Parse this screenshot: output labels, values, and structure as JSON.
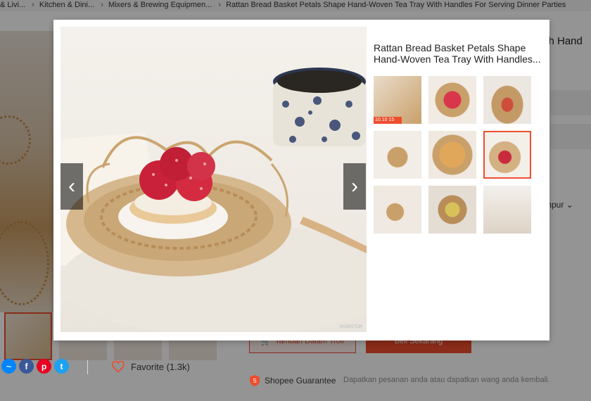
{
  "breadcrumb": {
    "items": [
      "& Livi...",
      "Kitchen & Dini...",
      "Mixers & Brewing Equipmen...",
      "Rattan Bread Basket Petals Shape Hand-Woven Tea Tray With Handles For Serving Dinner Parties"
    ]
  },
  "page": {
    "title_partial": "ith Hand",
    "option_partial": "mpur",
    "add_to_cart_label": "Tambah Dalam Troli",
    "buy_now_label": "Beli Sekarang",
    "favorite_label": "Favorite (1.3k)",
    "guarantee_label": "Shopee Guarantee",
    "guarantee_desc": "Dapatkan pesanan anda atau dapatkan wang anda kembali.",
    "share_icons": [
      "messenger-icon",
      "facebook-icon",
      "pinterest-icon",
      "twitter-icon"
    ]
  },
  "modal": {
    "title": "Rattan Bread Basket Petals Shape Hand-Woven Tea Tray With Handles...",
    "watermark": "INOMSTOR",
    "thumbnails": [
      {
        "name": "thumb-1",
        "badge": "10.10 15"
      },
      {
        "name": "thumb-2",
        "badge": ""
      },
      {
        "name": "thumb-3",
        "badge": ""
      },
      {
        "name": "thumb-4",
        "badge": ""
      },
      {
        "name": "thumb-5",
        "badge": ""
      },
      {
        "name": "thumb-6",
        "badge": ""
      },
      {
        "name": "thumb-7",
        "badge": ""
      },
      {
        "name": "thumb-8",
        "badge": ""
      },
      {
        "name": "thumb-9",
        "badge": ""
      }
    ],
    "selected_index": 5
  },
  "colors": {
    "accent": "#ee4d2d",
    "facebook": "#3b5998",
    "messenger": "#0084ff",
    "pinterest": "#e60023",
    "twitter": "#1da1f2"
  }
}
